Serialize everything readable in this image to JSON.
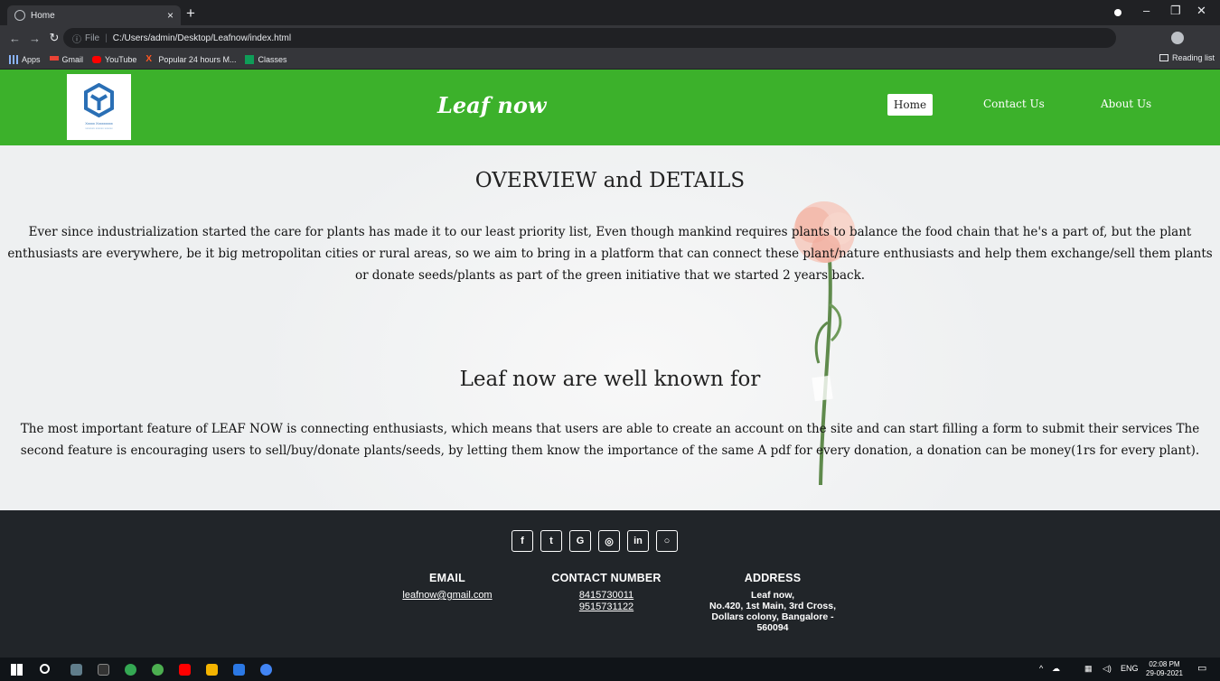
{
  "browser": {
    "tab_title": "Home",
    "tab_close": "×",
    "new_tab": "+",
    "url_info": "ⓘ",
    "url_file_label": "File",
    "url_separator": "|",
    "url": "C:/Users/admin/Desktop/Leafnow/index.html",
    "bookmarks": [
      "Apps",
      "Gmail",
      "YouTube",
      "Popular 24 hours M...",
      "Classes"
    ],
    "reading_list": "Reading list",
    "window_controls": {
      "minimize": "–",
      "restore": "❐",
      "close": "✕"
    }
  },
  "site": {
    "logo_text_line1": "Xxxxx Xxxxxxxxx",
    "logo_text_line2": "xxxxxxx xxxxxx xxxxxx",
    "brand": "Leaf now",
    "nav": {
      "home": "Home",
      "contact": "Contact Us",
      "about": "About Us"
    },
    "overview_title": "OVERVIEW and DETAILS",
    "overview_text": "Ever since industrialization started the care for plants has made it to our least priority list, Even though mankind requires plants to balance the food chain that he's a part of, but the plant enthusiasts are everywhere, be it big metropolitan cities or rural areas, so we aim to bring in a platform that can connect these plant/nature enthusiasts and help them exchange/sell them plants or donate seeds/plants as part of the green initiative that we started 2 years back.",
    "known_title": "Leaf now are well known for",
    "known_text": "The most important feature of LEAF NOW is connecting enthusiasts, which means that users are able to create an account on the site and can start filling a form to submit their services The second feature is encouraging users to sell/buy/donate plants/seeds, by letting them know the importance of the same A pdf for every donation, a donation can be money(1rs for every plant)."
  },
  "footer": {
    "social_icons": [
      "facebook-icon",
      "twitter-icon",
      "google-icon",
      "instagram-icon",
      "linkedin-icon",
      "github-icon"
    ],
    "social_glyphs": {
      "facebook": "f",
      "twitter": "t",
      "google": "G",
      "instagram": "◎",
      "linkedin": "in",
      "github": "○"
    },
    "email_heading": "EMAIL",
    "email": "leafnow@gmail.com",
    "contact_heading": "CONTACT NUMBER",
    "phone1": "8415730011",
    "phone2": "9515731122",
    "address_heading": "ADDRESS",
    "address_line1": "Leaf now,",
    "address_line2": "No.420, 1st Main, 3rd Cross,",
    "address_line3": "Dollars colony, Bangalore -",
    "address_line4": "560094"
  },
  "taskbar": {
    "tray_lang": "ENG",
    "time": "02:08 PM",
    "date": "29-09-2021"
  },
  "colors": {
    "header_green": "#3cb12b",
    "footer_dark": "#212529",
    "page_bg": "#eef0f1"
  }
}
